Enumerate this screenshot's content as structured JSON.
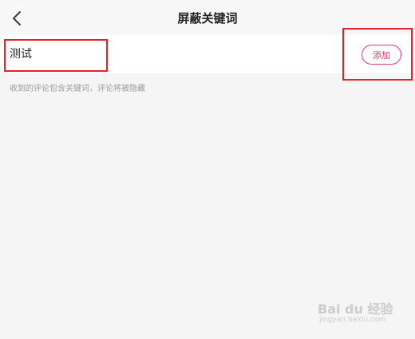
{
  "header": {
    "title": "屏蔽关键词",
    "back_icon": "chevron-left-icon"
  },
  "keyword_input": {
    "value": "测试"
  },
  "add_button": {
    "label": "添加",
    "color": "#e8366d"
  },
  "hint": {
    "text": "收到的评论包含关键词，评论将被隐藏"
  },
  "highlight": {
    "color": "#e8202a"
  },
  "watermark": {
    "main": "Bai du 经验",
    "sub": "jingyan.baidu.com"
  }
}
